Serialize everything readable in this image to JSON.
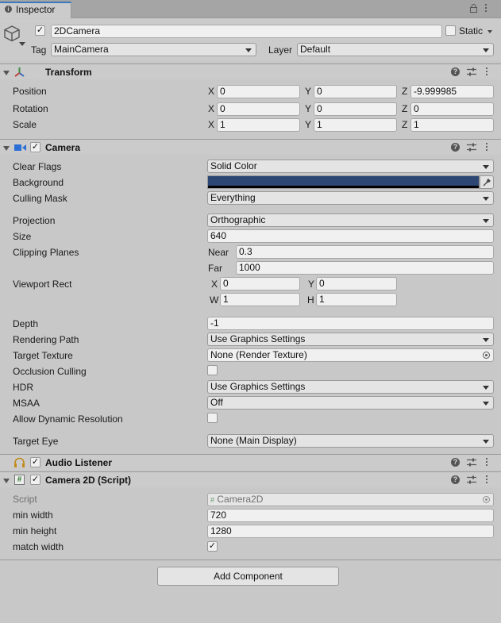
{
  "window": {
    "tab_label": "Inspector"
  },
  "gameobject": {
    "name": "2DCamera",
    "active": true,
    "static_label": "Static",
    "static": false,
    "tag_label": "Tag",
    "tag_value": "MainCamera",
    "layer_label": "Layer",
    "layer_value": "Default"
  },
  "transform": {
    "title": "Transform",
    "position": {
      "label": "Position",
      "x": "0",
      "y": "0",
      "z": "-9.999985"
    },
    "rotation": {
      "label": "Rotation",
      "x": "0",
      "y": "0",
      "z": "0"
    },
    "scale": {
      "label": "Scale",
      "x": "1",
      "y": "1",
      "z": "1"
    },
    "axis_x": "X",
    "axis_y": "Y",
    "axis_z": "Z"
  },
  "camera": {
    "title": "Camera",
    "enabled": true,
    "clear_flags": {
      "label": "Clear Flags",
      "value": "Solid Color"
    },
    "background": {
      "label": "Background",
      "color": "#2c4773"
    },
    "culling_mask": {
      "label": "Culling Mask",
      "value": "Everything"
    },
    "projection": {
      "label": "Projection",
      "value": "Orthographic"
    },
    "size": {
      "label": "Size",
      "value": "640"
    },
    "clipping": {
      "label": "Clipping Planes",
      "near_label": "Near",
      "near": "0.3",
      "far_label": "Far",
      "far": "1000"
    },
    "viewport": {
      "label": "Viewport Rect",
      "x_label": "X",
      "x": "0",
      "y_label": "Y",
      "y": "0",
      "w_label": "W",
      "w": "1",
      "h_label": "H",
      "h": "1"
    },
    "depth": {
      "label": "Depth",
      "value": "-1"
    },
    "rendering_path": {
      "label": "Rendering Path",
      "value": "Use Graphics Settings"
    },
    "target_texture": {
      "label": "Target Texture",
      "value": "None (Render Texture)"
    },
    "occlusion_culling": {
      "label": "Occlusion Culling",
      "checked": false
    },
    "hdr": {
      "label": "HDR",
      "value": "Use Graphics Settings"
    },
    "msaa": {
      "label": "MSAA",
      "value": "Off"
    },
    "dynamic_resolution": {
      "label": "Allow Dynamic Resolution",
      "checked": false
    },
    "target_eye": {
      "label": "Target Eye",
      "value": "None (Main Display)"
    }
  },
  "audio_listener": {
    "title": "Audio Listener",
    "enabled": true
  },
  "camera2d": {
    "title": "Camera 2D (Script)",
    "enabled": true,
    "script": {
      "label": "Script",
      "value": "Camera2D"
    },
    "min_width": {
      "label": "min width",
      "value": "720"
    },
    "min_height": {
      "label": "min height",
      "value": "1280"
    },
    "match_width": {
      "label": "match width",
      "checked": true
    }
  },
  "add_component_label": "Add Component",
  "colors": {
    "accent": "#3a79bb",
    "panel": "#c8c8c8",
    "header": "#cbcbcb"
  },
  "icons": [
    "info-icon",
    "lock-icon",
    "menu-icon",
    "gameobject-cube-icon",
    "transform-icon",
    "camera-icon",
    "headphones-icon",
    "script-hash-icon",
    "help-icon",
    "preset-icon",
    "color-picker-icon",
    "object-picker-icon"
  ]
}
